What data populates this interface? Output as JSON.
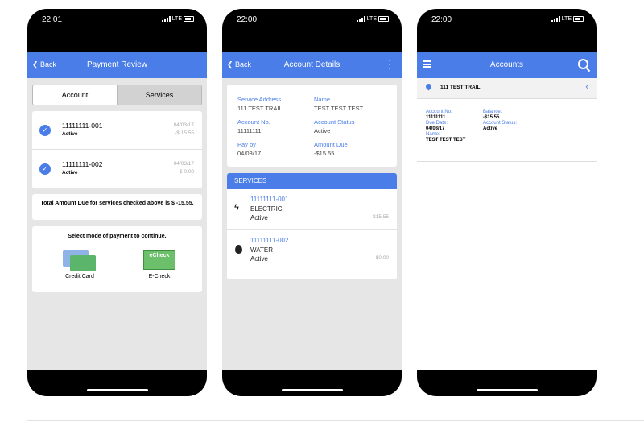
{
  "phones": [
    {
      "status_time": "22:01",
      "status_network": "LTE",
      "nav": {
        "back": "Back",
        "title": "Payment Review"
      },
      "tabs": [
        "Account",
        "Services"
      ],
      "accounts": [
        {
          "number": "11111111-001",
          "status": "Active",
          "date": "04/03/17",
          "amount": "-$ 15.55"
        },
        {
          "number": "11111111-002",
          "status": "Active",
          "date": "04/03/17",
          "amount": "$ 0.00"
        }
      ],
      "total_text": "Total Amount Due for services checked above is $ -15.55.",
      "payment_prompt": "Select mode of payment to continue.",
      "payment_options": [
        {
          "label": "Credit Card",
          "icon": "credit-card-icon"
        },
        {
          "label": "E-Check",
          "icon_text": "eCheck",
          "icon": "echeck-icon"
        }
      ]
    },
    {
      "status_time": "22:00",
      "status_network": "LTE",
      "nav": {
        "back": "Back",
        "title": "Account Details"
      },
      "details": [
        {
          "label": "Service Address",
          "value": "111 TEST TRAIL"
        },
        {
          "label": "Name",
          "value": "TEST TEST TEST"
        },
        {
          "label": "Account No.",
          "value": "11111111"
        },
        {
          "label": "Account Status",
          "value": "Active"
        },
        {
          "label": "Pay by",
          "value": "04/03/17"
        },
        {
          "label": "Amount Due",
          "value": "-$15.55"
        }
      ],
      "services_header": "SERVICES",
      "services": [
        {
          "number": "11111111-001",
          "type": "ELECTRIC",
          "status": "Active",
          "amount": "-$15.55",
          "icon": "lightning-icon"
        },
        {
          "number": "11111111-002",
          "type": "WATER",
          "status": "Active",
          "amount": "$0.00",
          "icon": "water-drop-icon"
        }
      ]
    },
    {
      "status_time": "22:00",
      "status_network": "LTE",
      "nav": {
        "title": "Accounts"
      },
      "location": "111 TEST TRAIL",
      "account": {
        "account_no_label": "Account No:",
        "account_no": "11111111",
        "balance_label": "Balance:",
        "balance": "-$15.55",
        "due_date_label": "Due Date:",
        "due_date": "04/03/17",
        "status_label": "Account Status:",
        "status": "Active",
        "name_label": "Name:",
        "name": "TEST TEST TEST"
      }
    }
  ],
  "colors": {
    "accent": "#4a7de8",
    "screen_bg": "#e6e6e6",
    "bezel": "#000000"
  }
}
